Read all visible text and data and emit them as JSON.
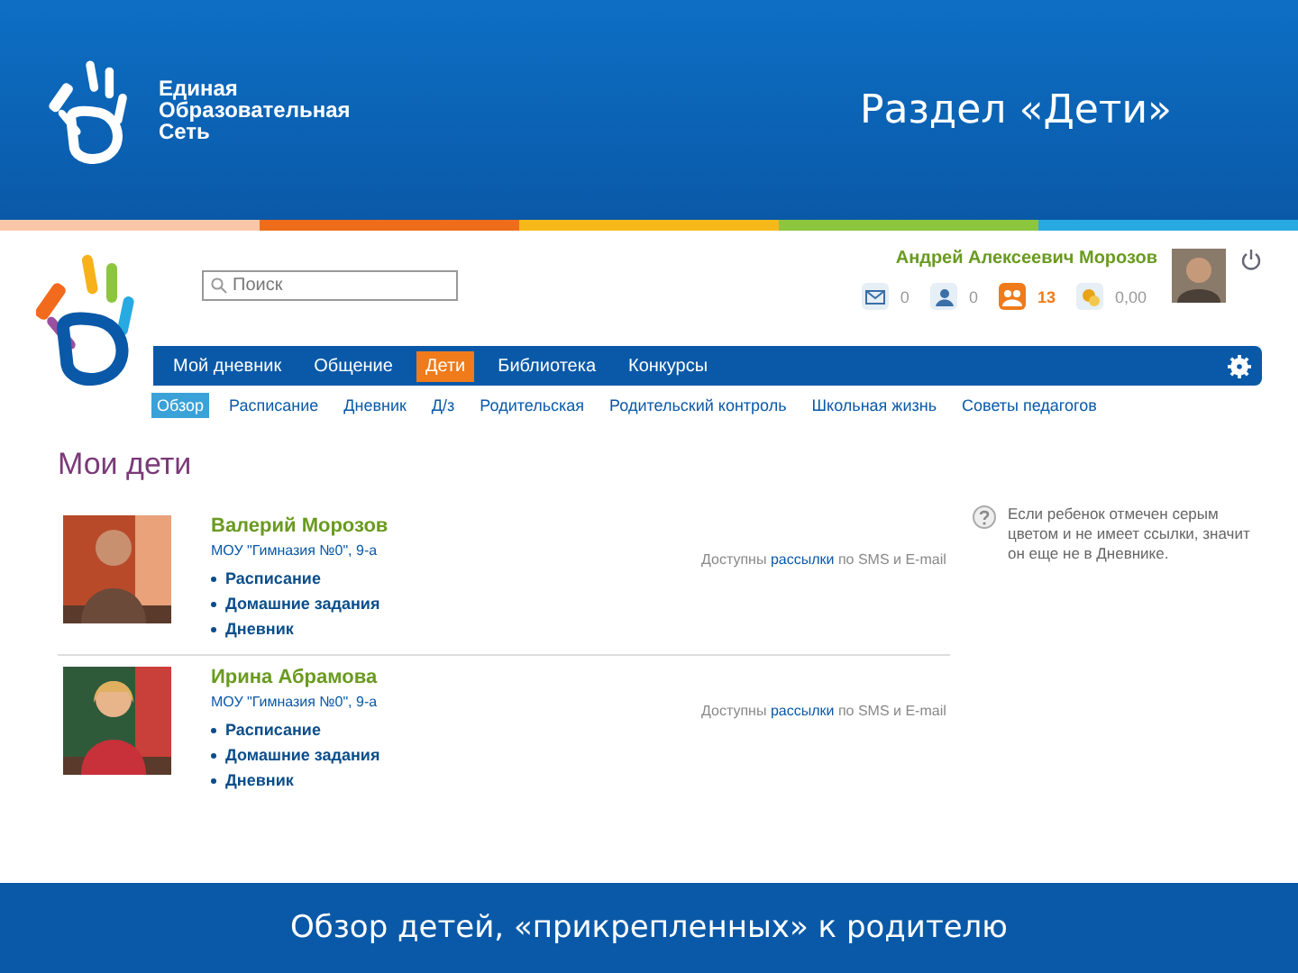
{
  "slide": {
    "logo_text": [
      "Единая",
      "Образовательная",
      "Сеть"
    ],
    "title": "Раздел «Дети»",
    "caption": "Обзор детей, «прикрепленных» к родителю"
  },
  "site": {
    "search": {
      "placeholder": "Поиск"
    },
    "user": {
      "name": "Андрей Алексеевич Морозов"
    },
    "counters": [
      {
        "kind": "mail",
        "value": "0"
      },
      {
        "kind": "person",
        "value": "0"
      },
      {
        "kind": "group",
        "value": "13"
      },
      {
        "kind": "coins",
        "value": "0,00"
      }
    ],
    "nav": [
      {
        "label": "Мой дневник",
        "selected": false
      },
      {
        "label": "Общение",
        "selected": false
      },
      {
        "label": "Дети",
        "selected": true
      },
      {
        "label": "Библиотека",
        "selected": false
      },
      {
        "label": "Конкурсы",
        "selected": false
      }
    ],
    "subnav": [
      {
        "label": "Обзор",
        "selected": true
      },
      {
        "label": "Расписание",
        "selected": false
      },
      {
        "label": "Дневник",
        "selected": false
      },
      {
        "label": "Д/з",
        "selected": false
      },
      {
        "label": "Родительская",
        "selected": false
      },
      {
        "label": "Родительский контроль",
        "selected": false
      },
      {
        "label": "Школьная жизнь",
        "selected": false
      },
      {
        "label": "Советы педагогов",
        "selected": false
      }
    ],
    "heading": "Мои дети",
    "children": [
      {
        "name": "Валерий Морозов",
        "school": "МОУ \"Гимназия №0\", 9-а",
        "links": [
          "Расписание",
          "Домашние задания",
          "Дневник"
        ],
        "mailing": "Доступны **рассылки** по SMS и E-mail"
      },
      {
        "name": "Ирина Абрамова",
        "school": "МОУ \"Гимназия №0\", 9-а",
        "links": [
          "Расписание",
          "Домашние задания",
          "Дневник"
        ],
        "mailing": "Доступны **рассылки** по SMS и E-mail"
      }
    ],
    "hint": "Если ребенок отмечен серым цветом и не имеет ссылки, значит он еще не в Дневнике."
  }
}
